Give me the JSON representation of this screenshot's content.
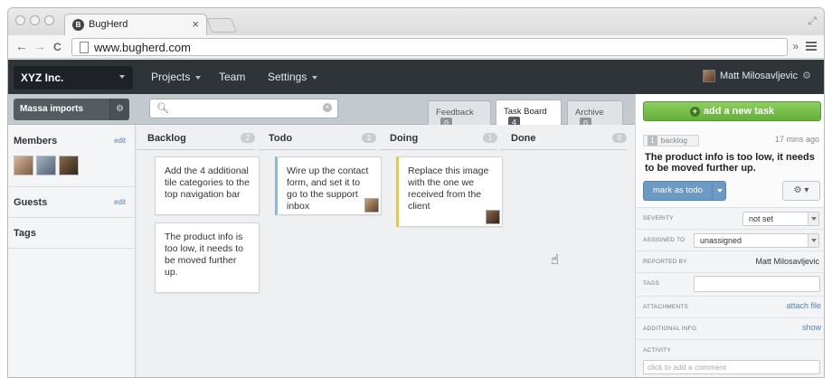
{
  "browser": {
    "tab_title": "BugHerd",
    "tab_favicon_letter": "B",
    "close_glyph": "×",
    "url": "www.bugherd.com",
    "nav": {
      "back": "←",
      "forward": "→",
      "reload": "C",
      "extensions": "»"
    }
  },
  "topbar": {
    "org": "XYZ Inc.",
    "menu": [
      {
        "label": "Projects"
      },
      {
        "label": "Team"
      },
      {
        "label": "Settings"
      }
    ],
    "user": "Matt Milosavljevic"
  },
  "subbar": {
    "project": "Massa imports",
    "search_placeholder": "",
    "tabs": [
      {
        "label": "Feedback",
        "count": "0"
      },
      {
        "label": "Task Board",
        "count": "4"
      },
      {
        "label": "Archive",
        "count": "0"
      }
    ]
  },
  "sidebar": {
    "members_title": "Members",
    "members_edit": "edit",
    "guests_title": "Guests",
    "guests_edit": "edit",
    "tags_title": "Tags"
  },
  "board": {
    "columns": [
      {
        "name": "Backlog",
        "count": "2"
      },
      {
        "name": "Todo",
        "count": "1"
      },
      {
        "name": "Doing",
        "count": "1"
      },
      {
        "name": "Done",
        "count": "0"
      }
    ],
    "cards": {
      "backlog1": "Add the 4 additional tile categories to the top navigation bar",
      "backlog2": "The product info is too low, it needs to be moved further up.",
      "todo1": "Wire up the contact form, and set it to go to the support inbox",
      "doing1": "Replace this image with the one we received from the client"
    }
  },
  "panel": {
    "add_task": "add a new task",
    "task_number": "1",
    "status_badge": "backlog",
    "time_ago": "17 mins ago",
    "title": "The product info is too low, it needs to be moved further up.",
    "primary_action": "mark as todo",
    "fields": {
      "severity_label": "SEVERITY",
      "severity_value": "not set",
      "assigned_label": "ASSIGNED TO",
      "assigned_value": "unassigned",
      "reported_label": "REPORTED BY",
      "reported_value": "Matt Milosavljevic",
      "tags_label": "TAGS",
      "attachments_label": "ATTACHMENTS",
      "attachments_link": "attach file",
      "additional_label": "ADDITIONAL INFO",
      "additional_link": "show",
      "activity_label": "ACTIVITY",
      "comment_placeholder": "click to add a comment"
    }
  },
  "colors": {
    "topbar_bg": "#2f3439",
    "add_button": "#76c04a",
    "primary_button": "#6b9ac4",
    "todo_accent": "#8cbad8",
    "doing_accent": "#e9c74c",
    "link": "#4d86b6"
  }
}
